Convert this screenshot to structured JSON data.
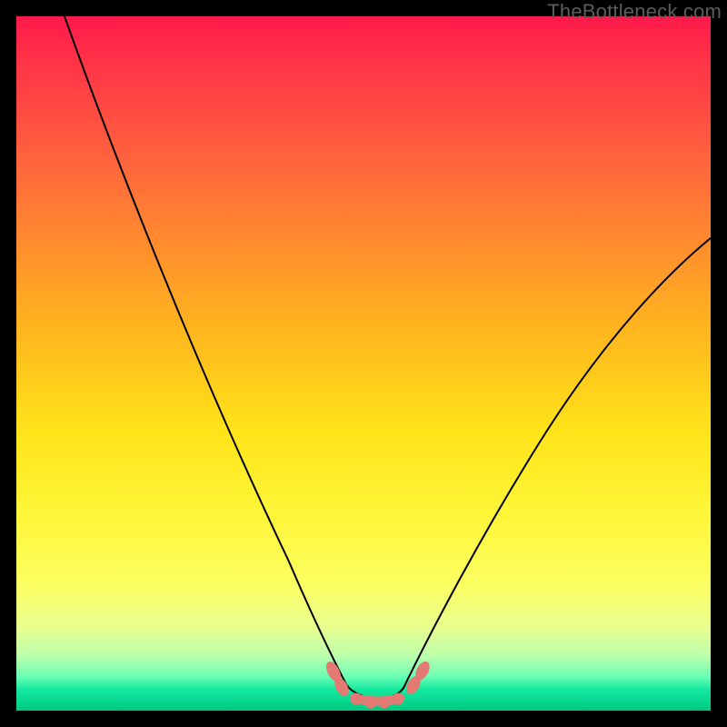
{
  "watermark": "TheBottleneck.com",
  "colors": {
    "frame": "#000000",
    "curve": "#000000",
    "marker": "#e47a74"
  },
  "chart_data": {
    "type": "line",
    "title": "",
    "xlabel": "",
    "ylabel": "",
    "xlim": [
      0,
      100
    ],
    "ylim": [
      0,
      100
    ],
    "background_gradient": {
      "top": 100,
      "bottom": 0,
      "stops": [
        {
          "pct": 0,
          "color": "#ff1a4a",
          "meaning": "high-bottleneck"
        },
        {
          "pct": 50,
          "color": "#ffd21e",
          "meaning": "mid"
        },
        {
          "pct": 97,
          "color": "#14e9a0",
          "meaning": "low-bottleneck"
        }
      ]
    },
    "series": [
      {
        "name": "left-branch",
        "x": [
          7,
          12,
          18,
          24,
          30,
          36,
          41,
          44,
          46,
          47.5
        ],
        "y": [
          100,
          84,
          68,
          52,
          37,
          23,
          12,
          6,
          3,
          1.5
        ]
      },
      {
        "name": "right-branch",
        "x": [
          56,
          58,
          62,
          68,
          75,
          82,
          90,
          100
        ],
        "y": [
          1.5,
          3,
          8,
          17,
          28,
          40,
          53,
          68
        ]
      },
      {
        "name": "valley-floor",
        "x": [
          47.5,
          49,
          51,
          53,
          55,
          56
        ],
        "y": [
          1.5,
          1.0,
          0.9,
          0.9,
          1.0,
          1.5
        ]
      }
    ],
    "markers": [
      {
        "name": "left-cluster-a",
        "x": 45.5,
        "y": 5.2
      },
      {
        "name": "left-cluster-b",
        "x": 46.7,
        "y": 2.8
      },
      {
        "name": "floor-a",
        "x": 49,
        "y": 1.0
      },
      {
        "name": "floor-b",
        "x": 51,
        "y": 0.9
      },
      {
        "name": "floor-c",
        "x": 53,
        "y": 0.9
      },
      {
        "name": "floor-d",
        "x": 55,
        "y": 1.0
      },
      {
        "name": "right-cluster-a",
        "x": 57.3,
        "y": 3.0
      },
      {
        "name": "right-cluster-b",
        "x": 58.5,
        "y": 5.0
      }
    ]
  }
}
